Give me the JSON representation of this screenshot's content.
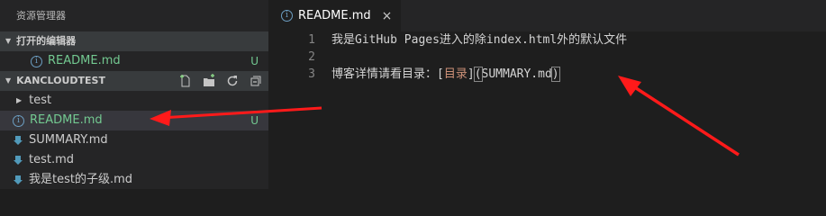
{
  "sidebar": {
    "title": "资源管理器",
    "open_editors": {
      "header": "打开的编辑器",
      "items": [
        {
          "name": "README.md",
          "status": "U"
        }
      ]
    },
    "project": {
      "header": "KANCLOUDTEST",
      "actions": [
        "new-file-icon",
        "new-folder-icon",
        "refresh-icon",
        "collapse-all-icon"
      ],
      "items": [
        {
          "name": "test",
          "type": "folder",
          "status": ""
        },
        {
          "name": "README.md",
          "type": "info-file",
          "status": "U"
        },
        {
          "name": "SUMMARY.md",
          "type": "markdown",
          "status": ""
        },
        {
          "name": "test.md",
          "type": "markdown",
          "status": ""
        },
        {
          "name": "我是test的子级.md",
          "type": "markdown",
          "status": ""
        }
      ]
    }
  },
  "editor": {
    "tab": {
      "label": "README.md",
      "close": "×"
    },
    "lines": [
      {
        "num": "1",
        "text": "我是GitHub Pages进入的除index.html外的默认文件"
      },
      {
        "num": "2",
        "text": ""
      },
      {
        "num": "3",
        "prefix": "博客详情请看目录：",
        "open_bracket": "[",
        "link_text": "目录",
        "close_bracket": "]",
        "open_paren": "(",
        "link_url": "SUMMARY.md",
        "close_paren": ")"
      }
    ]
  },
  "colors": {
    "accent_green": "#73c991",
    "annotation_red": "#ff1a1a",
    "sidebar_bg": "#252526",
    "editor_bg": "#1e1e1e"
  }
}
